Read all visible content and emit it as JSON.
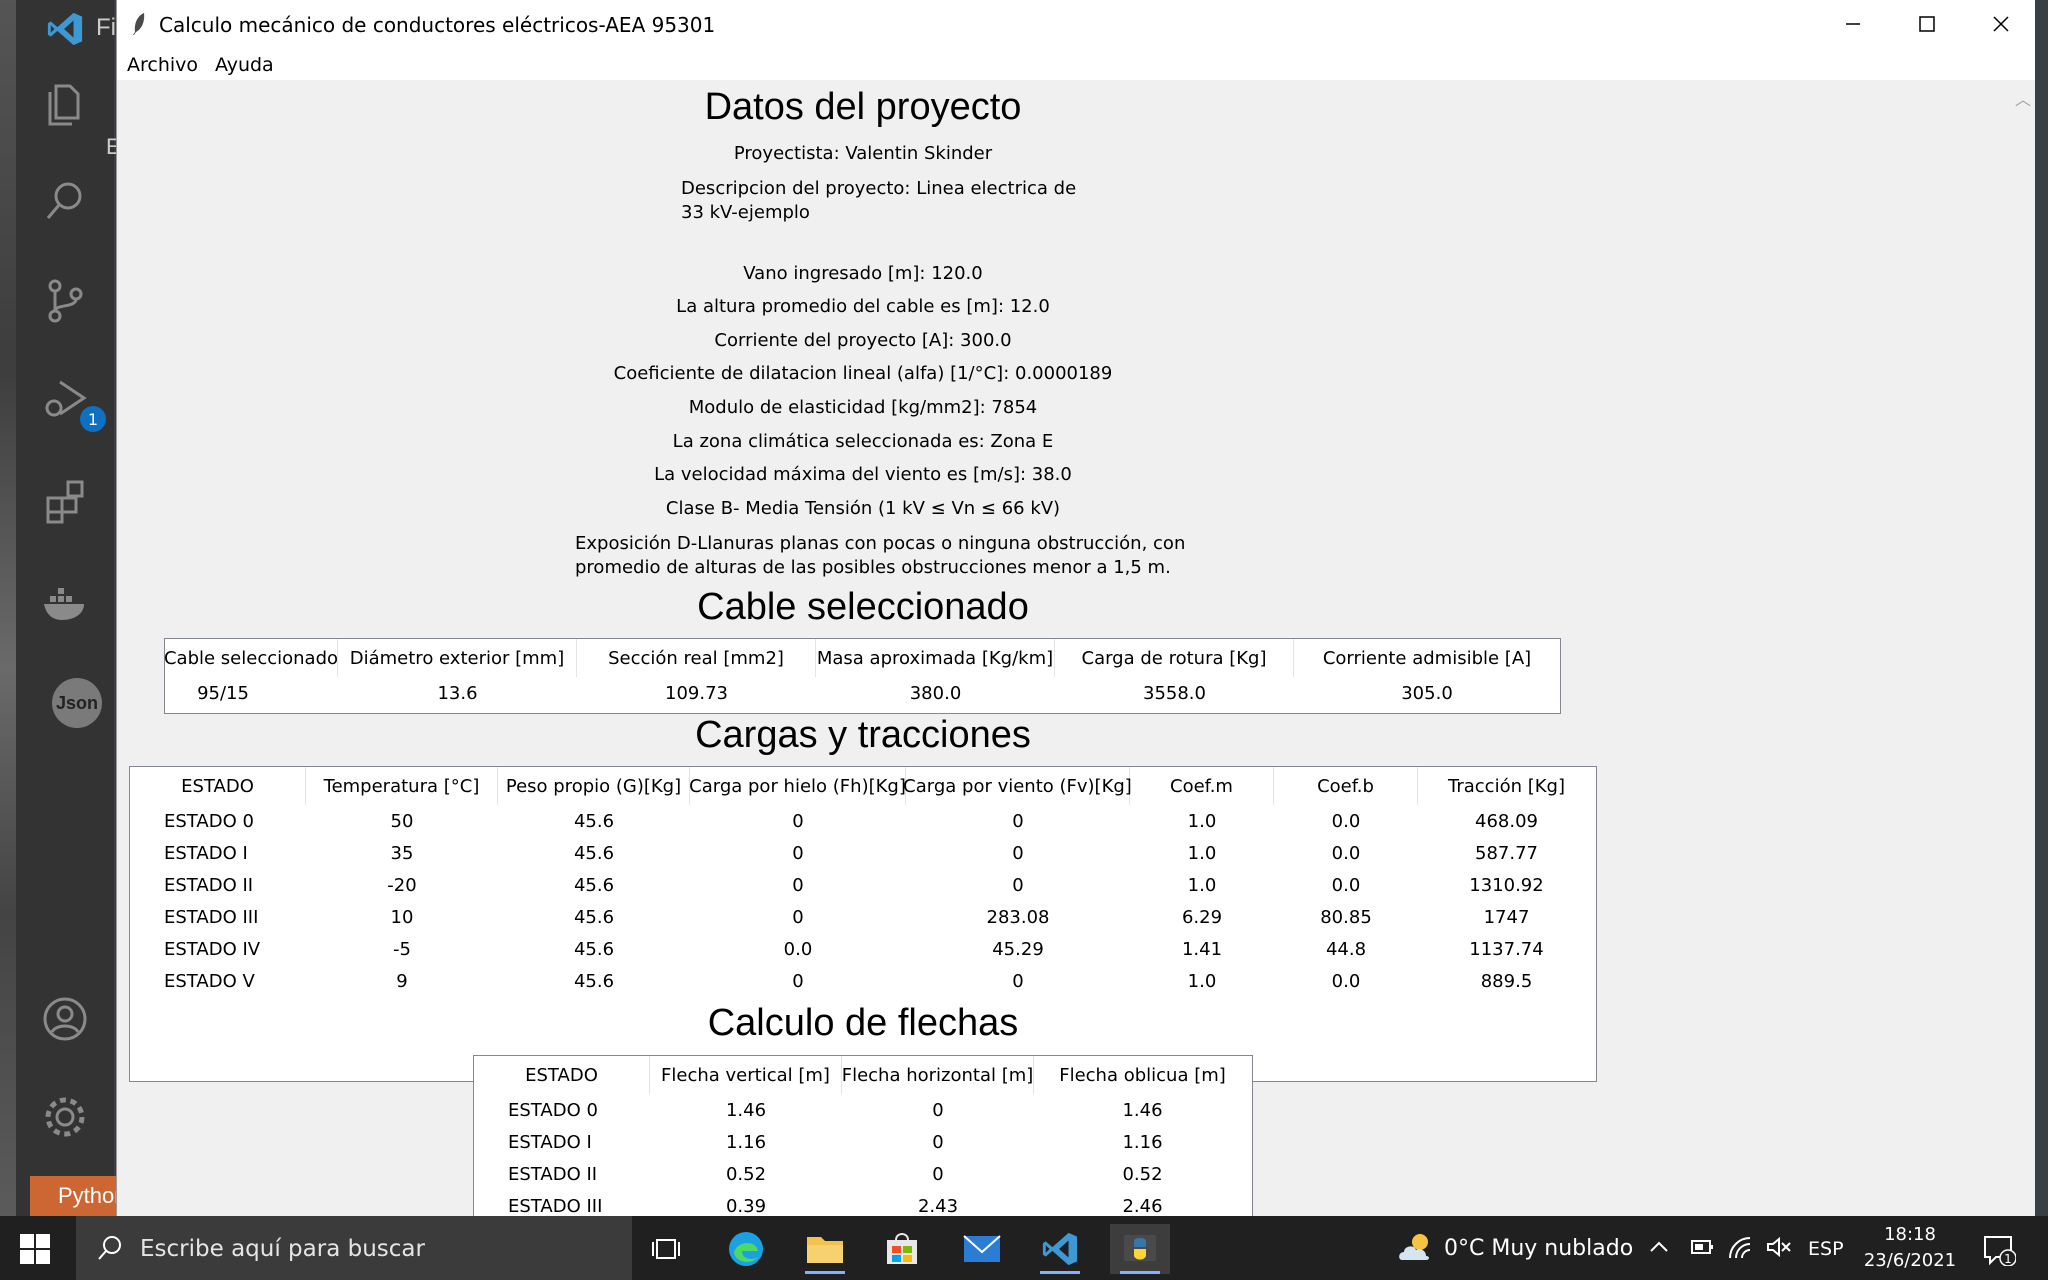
{
  "vscode": {
    "menu_fragment": "Fi",
    "explorer_fragment": "E",
    "debug_badge": "1",
    "json_label": "Json",
    "status_python": "Python"
  },
  "window": {
    "title": "Calculo mecánico de conductores eléctricos-AEA 95301",
    "menu": [
      "Archivo",
      "Ayuda"
    ]
  },
  "project": {
    "heading": "Datos del proyecto",
    "designer": "Proyectista: Valentin Skinder",
    "description_line1": "Descripcion del proyecto: Linea electrica de",
    "description_line2": "33 kV-ejemplo",
    "span": "Vano ingresado [m]: 120.0",
    "height": "La altura promedio del cable es [m]: 12.0",
    "current": "Corriente del proyecto [A]: 300.0",
    "alpha": "Coeficiente de dilatacion lineal (alfa) [1/°C]: 0.0000189",
    "elasticity": "Modulo de elasticidad [kg/mm2]: 7854",
    "zone": "La zona climática seleccionada es: Zona E",
    "wind": "La velocidad máxima del viento es [m/s]: 38.0",
    "class": "Clase B- Media Tensión (1 kV ≤ Vn ≤ 66 kV)",
    "exposure_line1": "Exposición D-Llanuras planas con pocas o ninguna obstrucción, con",
    "exposure_line2": "promedio de alturas de las posibles obstrucciones menor a 1,5 m."
  },
  "cable": {
    "heading": "Cable seleccionado",
    "columns": [
      "Cable seleccionado",
      "Diámetro exterior [mm]",
      "Sección real [mm2]",
      "Masa aproximada [Kg/km]",
      "Carga de rotura [Kg]",
      "Corriente admisible [A]"
    ],
    "row": [
      "95/15",
      "13.6",
      "109.73",
      "380.0",
      "3558.0",
      "305.0"
    ]
  },
  "loads": {
    "heading": "Cargas y tracciones",
    "columns": [
      "ESTADO",
      "Temperatura [°C]",
      "Peso propio (G)[Kg]",
      "Carga por hielo (Fh)[Kg]",
      "Carga por viento (Fv)[Kg]",
      "Coef.m",
      "Coef.b",
      "Tracción [Kg]"
    ],
    "rows": [
      [
        "ESTADO 0",
        "50",
        "45.6",
        "0",
        "0",
        "1.0",
        "0.0",
        "468.09"
      ],
      [
        "ESTADO I",
        "35",
        "45.6",
        "0",
        "0",
        "1.0",
        "0.0",
        "587.77"
      ],
      [
        "ESTADO II",
        "-20",
        "45.6",
        "0",
        "0",
        "1.0",
        "0.0",
        "1310.92"
      ],
      [
        "ESTADO III",
        "10",
        "45.6",
        "0",
        "283.08",
        "6.29",
        "80.85",
        "1747"
      ],
      [
        "ESTADO IV",
        "-5",
        "45.6",
        "0.0",
        "45.29",
        "1.41",
        "44.8",
        "1137.74"
      ],
      [
        "ESTADO V",
        "9",
        "45.6",
        "0",
        "0",
        "1.0",
        "0.0",
        "889.5"
      ]
    ]
  },
  "sag": {
    "heading": "Calculo de flechas",
    "columns": [
      "ESTADO",
      "Flecha vertical [m]",
      "Flecha horizontal [m]",
      "Flecha oblicua [m]"
    ],
    "rows": [
      [
        "ESTADO 0",
        "1.46",
        "0",
        "1.46"
      ],
      [
        "ESTADO I",
        "1.16",
        "0",
        "1.16"
      ],
      [
        "ESTADO II",
        "0.52",
        "0",
        "0.52"
      ],
      [
        "ESTADO III",
        "0.39",
        "2.43",
        "2.46"
      ]
    ]
  },
  "taskbar": {
    "search_placeholder": "Escribe aquí para buscar",
    "weather": "0°C  Muy nublado",
    "language": "ESP",
    "time": "18:18",
    "date": "23/6/2021",
    "notification_count": "1"
  }
}
